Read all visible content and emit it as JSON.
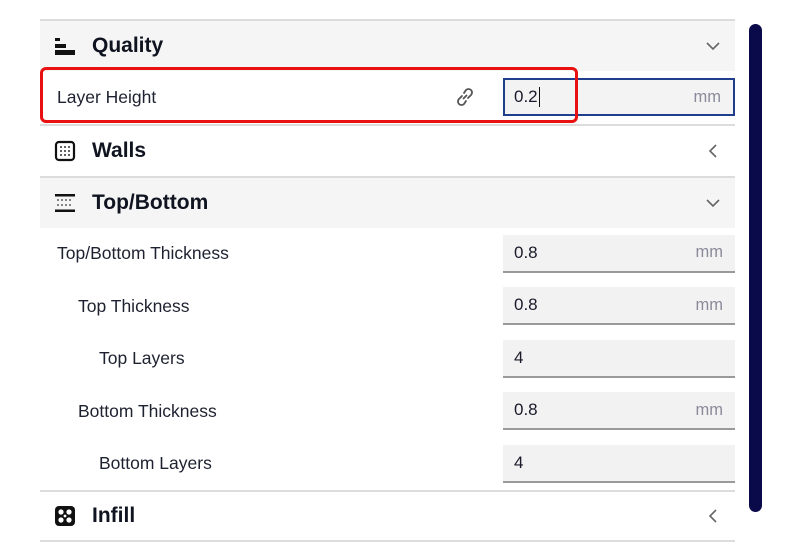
{
  "sections": [
    {
      "title": "Quality",
      "icon": "quality-layers-icon",
      "state": "expanded",
      "settings": [
        {
          "label": "Layer Height",
          "value": "0.2",
          "unit": "mm",
          "linked": true,
          "focused": true,
          "highlighted": true
        }
      ]
    },
    {
      "title": "Walls",
      "icon": "walls-icon",
      "state": "collapsed",
      "settings": []
    },
    {
      "title": "Top/Bottom",
      "icon": "top-bottom-icon",
      "state": "expanded",
      "settings": [
        {
          "label": "Top/Bottom Thickness",
          "value": "0.8",
          "unit": "mm",
          "indent": 0
        },
        {
          "label": "Top Thickness",
          "value": "0.8",
          "unit": "mm",
          "indent": 1
        },
        {
          "label": "Top Layers",
          "value": "4",
          "unit": "",
          "indent": 2
        },
        {
          "label": "Bottom Thickness",
          "value": "0.8",
          "unit": "mm",
          "indent": 1
        },
        {
          "label": "Bottom Layers",
          "value": "4",
          "unit": "",
          "indent": 2
        }
      ]
    },
    {
      "title": "Infill",
      "icon": "infill-icon",
      "state": "collapsed",
      "settings": []
    }
  ],
  "colors": {
    "highlight": "#e81010",
    "focus_border": "#1f3f8c",
    "scrollbar": "#0a0a4a"
  }
}
